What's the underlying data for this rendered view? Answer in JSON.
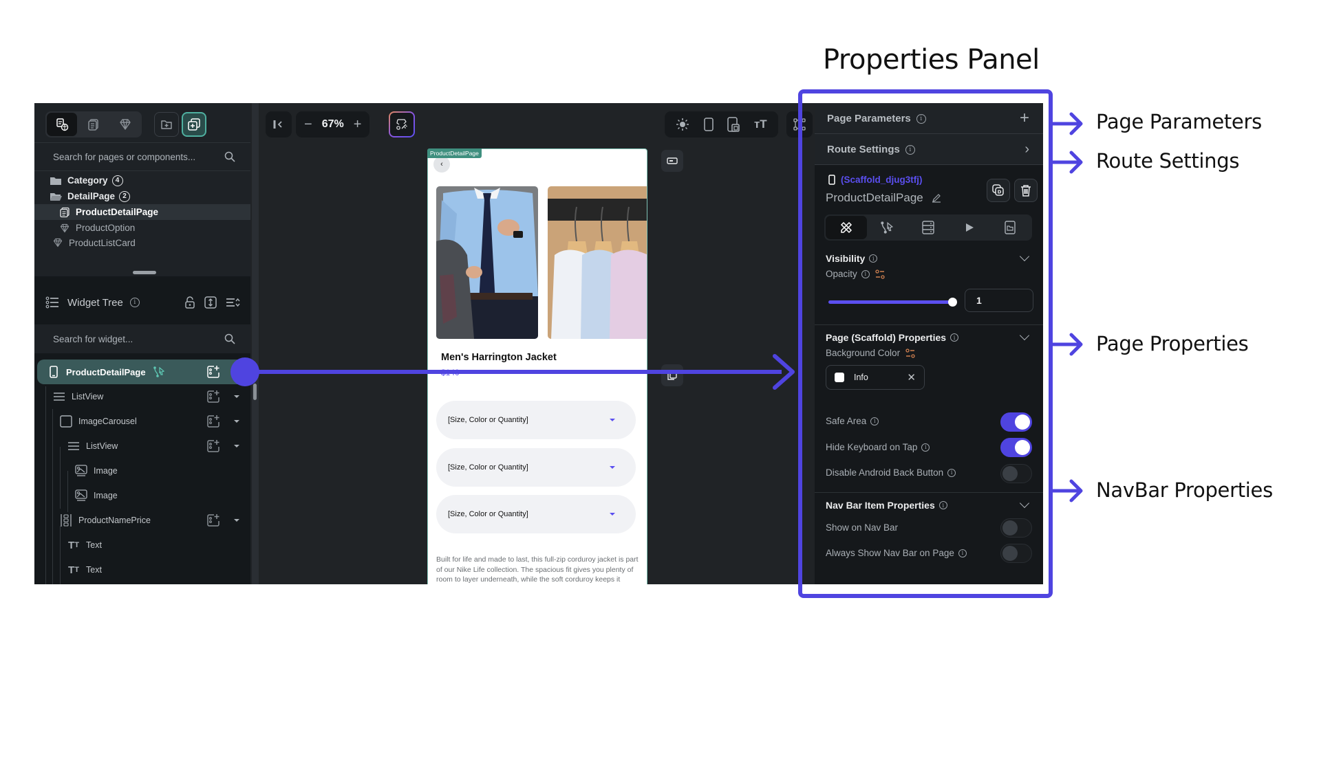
{
  "annotations": {
    "title": "Properties Panel",
    "labels": [
      "Page Parameters",
      "Route Settings",
      "Page Properties",
      "NavBar Properties"
    ],
    "accent": "#4f44e0"
  },
  "left_panel": {
    "mode_tabs": [
      {
        "icon": "pages-components-icon",
        "active": true
      },
      {
        "icon": "pages-icon",
        "active": false
      },
      {
        "icon": "components-icon",
        "active": false
      }
    ],
    "add_folder_icon": "folder-add-icon",
    "add_page_icon": "add-page-icon",
    "search_placeholder": "Search for pages or components...",
    "tree": [
      {
        "label": "Category",
        "type": "folder",
        "count": "4"
      },
      {
        "label": "DetailPage",
        "type": "folder-open",
        "count": "2"
      },
      {
        "label": "ProductDetailPage",
        "type": "page",
        "selected": true
      },
      {
        "label": "ProductOption",
        "type": "component"
      },
      {
        "label": "ProductListCard",
        "type": "component"
      }
    ]
  },
  "widget_tree": {
    "title": "Widget Tree",
    "search_placeholder": "Search for widget...",
    "items": [
      {
        "label": "ProductDetailPage",
        "icon": "phone-icon",
        "selected": true
      },
      {
        "label": "ListView",
        "icon": "list-icon"
      },
      {
        "label": "ImageCarousel",
        "icon": "container-icon"
      },
      {
        "label": "ListView",
        "icon": "list-icon"
      },
      {
        "label": "Image",
        "icon": "image-icon"
      },
      {
        "label": "Image",
        "icon": "image-icon"
      },
      {
        "label": "ProductNamePrice",
        "icon": "column-icon"
      },
      {
        "label": "Text",
        "icon": "text-icon"
      },
      {
        "label": "Text",
        "icon": "text-icon"
      }
    ]
  },
  "canvas": {
    "zoom_level": "67%",
    "page_tag": "ProductDetailPage",
    "product_name": "Men's Harrington Jacket",
    "product_price": "$140",
    "dropdowns": [
      "[Size, Color or Quantity]",
      "[Size, Color or Quantity]",
      "[Size, Color or Quantity]"
    ],
    "description": "Built for life and made to last, this full-zip corduroy jacket is part of our Nike Life collection. The spacious fit gives you plenty of room to layer underneath, while the soft corduroy keeps it casual and timeless."
  },
  "properties": {
    "page_parameters": "Page Parameters",
    "route_settings": "Route Settings",
    "scaffold_id": "(Scaffold_djug3tfj)",
    "scaffold_name": "ProductDetailPage",
    "visibility": {
      "title": "Visibility",
      "opacity_label": "Opacity",
      "opacity_value": "1",
      "opacity_fraction": 1.0
    },
    "page_props": {
      "title": "Page (Scaffold) Properties",
      "bg_label": "Background Color",
      "bg_value": "Info",
      "safe_area": {
        "label": "Safe Area",
        "on": true
      },
      "hide_keyboard": {
        "label": "Hide Keyboard on Tap",
        "on": true
      },
      "disable_back": {
        "label": "Disable Android Back Button",
        "on": false
      }
    },
    "navbar": {
      "title": "Nav Bar Item Properties",
      "show_on_nav": {
        "label": "Show on Nav Bar",
        "on": false
      },
      "always_show": {
        "label": "Always Show Nav Bar on Page",
        "on": false
      }
    }
  }
}
